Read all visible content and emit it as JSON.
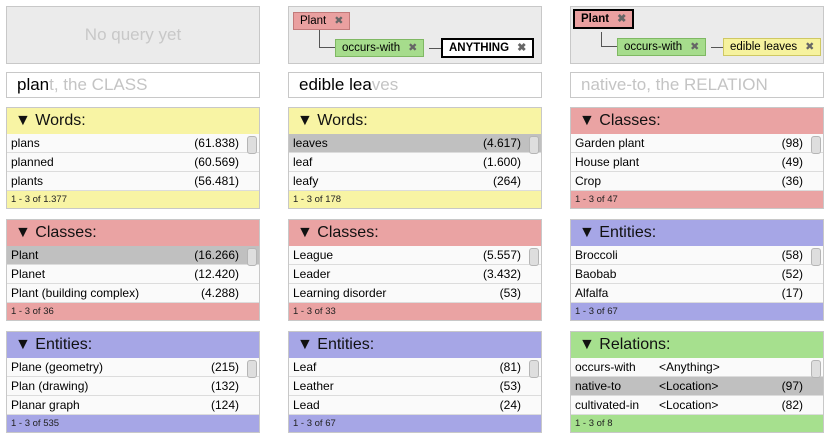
{
  "col1": {
    "query_empty": "No query yet",
    "search": {
      "typed": "plan",
      "ghost": "t, the CLASS"
    },
    "words": {
      "header": "▼ Words:",
      "rows": [
        {
          "label": "plans",
          "count": "(61.838)"
        },
        {
          "label": "planned",
          "count": "(60.569)"
        },
        {
          "label": "plants",
          "count": "(56.481)"
        }
      ],
      "footer": "1 - 3 of 1.377"
    },
    "classes": {
      "header": "▼ Classes:",
      "rows": [
        {
          "label": "Plant",
          "count": "(16.266)",
          "selected": true
        },
        {
          "label": "Planet",
          "count": "(12.420)"
        },
        {
          "label": "Plant (building complex)",
          "count": "(4.288)"
        }
      ],
      "footer": "1 - 3 of 36"
    },
    "entities": {
      "header": "▼ Entities:",
      "rows": [
        {
          "label": "Plane (geometry)",
          "count": "(215)"
        },
        {
          "label": "Plan (drawing)",
          "count": "(132)"
        },
        {
          "label": "Planar graph",
          "count": "(124)"
        }
      ],
      "footer": "1 - 3 of 535"
    }
  },
  "col2": {
    "query": {
      "root": "Plant",
      "relation": "occurs-with",
      "target": "ANYTHING",
      "remove_glyph": "✖"
    },
    "search": {
      "typed": "edible lea",
      "ghost": "ves"
    },
    "words": {
      "header": "▼ Words:",
      "rows": [
        {
          "label": "leaves",
          "count": "(4.617)",
          "selected": true
        },
        {
          "label": "leaf",
          "count": "(1.600)"
        },
        {
          "label": "leafy",
          "count": "(264)"
        }
      ],
      "footer": "1 - 3 of 178"
    },
    "classes": {
      "header": "▼ Classes:",
      "rows": [
        {
          "label": "League",
          "count": "(5.557)"
        },
        {
          "label": "Leader",
          "count": "(3.432)"
        },
        {
          "label": "Learning disorder",
          "count": "(53)"
        }
      ],
      "footer": "1 - 3 of 33"
    },
    "entities": {
      "header": "▼ Entities:",
      "rows": [
        {
          "label": "Leaf",
          "count": "(81)"
        },
        {
          "label": "Leather",
          "count": "(53)"
        },
        {
          "label": "Lead",
          "count": "(24)"
        }
      ],
      "footer": "1 - 3 of 67"
    }
  },
  "col3": {
    "query": {
      "root": "Plant",
      "relation": "occurs-with",
      "target": "edible leaves",
      "remove_glyph": "✖"
    },
    "search": {
      "typed": "",
      "ghost": "native-to, the RELATION"
    },
    "classes": {
      "header": "▼ Classes:",
      "rows": [
        {
          "label": "Garden plant",
          "count": "(98)"
        },
        {
          "label": "House plant",
          "count": "(49)"
        },
        {
          "label": "Crop",
          "count": "(36)"
        }
      ],
      "footer": "1 - 3 of 47"
    },
    "entities": {
      "header": "▼ Entities:",
      "rows": [
        {
          "label": "Broccoli",
          "count": "(58)"
        },
        {
          "label": "Baobab",
          "count": "(52)"
        },
        {
          "label": "Alfalfa",
          "count": "(17)"
        }
      ],
      "footer": "1 - 3 of 67"
    },
    "relations": {
      "header": "▼ Relations:",
      "rows": [
        {
          "label": "occurs-with",
          "arg": "<Anything>",
          "count": ""
        },
        {
          "label": "native-to",
          "arg": "<Location>",
          "count": "(97)",
          "selected": true
        },
        {
          "label": "cultivated-in",
          "arg": "<Location>",
          "count": "(82)"
        }
      ],
      "footer": "1 - 3 of 8"
    }
  },
  "colors": {
    "words": "#f8f4a4",
    "classes": "#eaa3a3",
    "entities": "#a6a6e6",
    "relations": "#a6e08e",
    "selected_row": "#c0c0c0"
  }
}
